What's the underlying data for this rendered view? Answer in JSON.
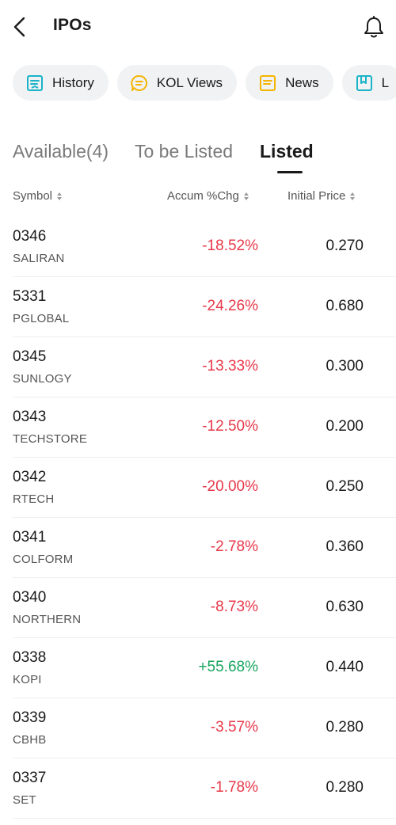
{
  "header": {
    "title": "IPOs"
  },
  "chips": [
    {
      "label": "History",
      "icon": "history-icon",
      "color": "#1ab3c8"
    },
    {
      "label": "KOL Views",
      "icon": "chat-bubble-icon",
      "color": "#f4b400"
    },
    {
      "label": "News",
      "icon": "news-icon",
      "color": "#f4b400"
    },
    {
      "label": "L",
      "icon": "bookmark-icon",
      "color": "#1ab3c8"
    }
  ],
  "tabs": [
    {
      "label": "Available(4)",
      "active": false
    },
    {
      "label": "To be Listed",
      "active": false
    },
    {
      "label": "Listed",
      "active": true
    }
  ],
  "columns": {
    "symbol": "Symbol",
    "chg": "Accum %Chg",
    "price": "Initial Price"
  },
  "rows": [
    {
      "code": "0346",
      "name": "SALIRAN",
      "chg": "-18.52%",
      "price": "0.270",
      "dir": "neg"
    },
    {
      "code": "5331",
      "name": "PGLOBAL",
      "chg": "-24.26%",
      "price": "0.680",
      "dir": "neg"
    },
    {
      "code": "0345",
      "name": "SUNLOGY",
      "chg": "-13.33%",
      "price": "0.300",
      "dir": "neg"
    },
    {
      "code": "0343",
      "name": "TECHSTORE",
      "chg": "-12.50%",
      "price": "0.200",
      "dir": "neg"
    },
    {
      "code": "0342",
      "name": "RTECH",
      "chg": "-20.00%",
      "price": "0.250",
      "dir": "neg"
    },
    {
      "code": "0341",
      "name": "COLFORM",
      "chg": "-2.78%",
      "price": "0.360",
      "dir": "neg"
    },
    {
      "code": "0340",
      "name": "NORTHERN",
      "chg": "-8.73%",
      "price": "0.630",
      "dir": "neg"
    },
    {
      "code": "0338",
      "name": "KOPI",
      "chg": "+55.68%",
      "price": "0.440",
      "dir": "pos"
    },
    {
      "code": "0339",
      "name": "CBHB",
      "chg": "-3.57%",
      "price": "0.280",
      "dir": "neg"
    },
    {
      "code": "0337",
      "name": "SET",
      "chg": "-1.78%",
      "price": "0.280",
      "dir": "neg"
    }
  ],
  "colors": {
    "negative": "#e8384a",
    "positive": "#19a660",
    "chip_bg": "#f0f2f4"
  }
}
